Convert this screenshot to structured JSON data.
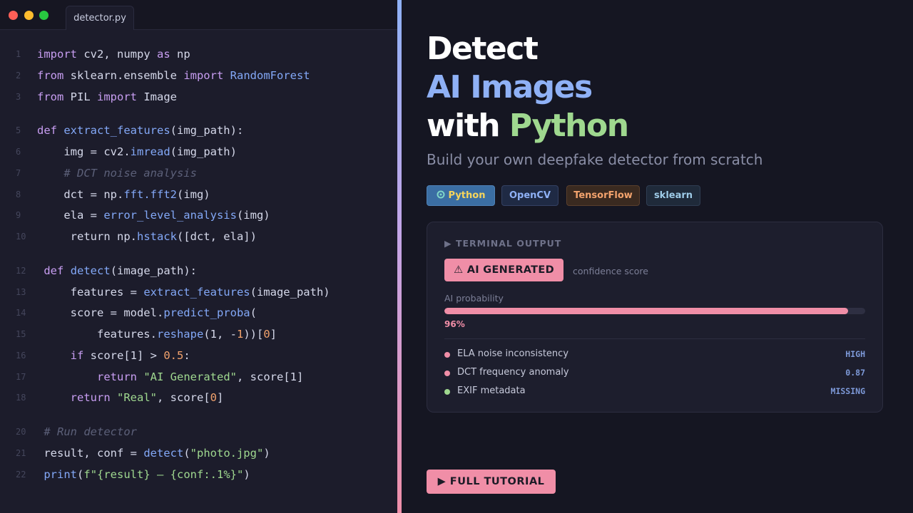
{
  "editor": {
    "tab_label": "detector.py",
    "window_controls": [
      {
        "name": "close",
        "color": "#ff5f57"
      },
      {
        "name": "minimize",
        "color": "#febc2e"
      },
      {
        "name": "maximize",
        "color": "#28c840"
      }
    ],
    "lines": [
      {
        "n": "1",
        "tokens": [
          [
            "kw",
            "import"
          ],
          [
            "pl",
            " cv2, numpy "
          ],
          [
            "kw",
            "as"
          ],
          [
            "pl",
            " np"
          ]
        ]
      },
      {
        "n": "2",
        "tokens": [
          [
            "kw",
            "from"
          ],
          [
            "pl",
            " sklearn.ensemble "
          ],
          [
            "kw",
            "import"
          ],
          [
            "pl",
            " "
          ],
          [
            "fn",
            "RandomForest"
          ]
        ]
      },
      {
        "n": "3",
        "tokens": [
          [
            "kw",
            "from"
          ],
          [
            "pl",
            " PIL "
          ],
          [
            "kw",
            "import"
          ],
          [
            "pl",
            " Image"
          ]
        ]
      },
      {
        "n": "5",
        "tokens": [
          [
            "kw",
            "def"
          ],
          [
            "pl",
            " "
          ],
          [
            "fn",
            "extract_features"
          ],
          [
            "pl",
            "(img_path):"
          ]
        ]
      },
      {
        "n": "6",
        "tokens": [
          [
            "pl",
            "    img = cv2."
          ],
          [
            "fn",
            "imread"
          ],
          [
            "pl",
            "(img_path)"
          ]
        ]
      },
      {
        "n": "7",
        "tokens": [
          [
            "cm",
            "    # DCT noise analysis"
          ]
        ]
      },
      {
        "n": "8",
        "tokens": [
          [
            "pl",
            "    dct = np."
          ],
          [
            "fn",
            "fft.fft2"
          ],
          [
            "pl",
            "(img)"
          ]
        ]
      },
      {
        "n": "9",
        "tokens": [
          [
            "pl",
            "    ela = "
          ],
          [
            "fn",
            "error_level_analysis"
          ],
          [
            "pl",
            "(img)"
          ]
        ]
      },
      {
        "n": "10",
        "tokens": [
          [
            "pl",
            "     return np."
          ],
          [
            "fn",
            "hstack"
          ],
          [
            "pl",
            "([dct, ela])"
          ]
        ]
      },
      {
        "n": "12",
        "tokens": [
          [
            "pl",
            " "
          ],
          [
            "kw",
            "def"
          ],
          [
            "pl",
            " "
          ],
          [
            "fn",
            "detect"
          ],
          [
            "pl",
            "(image_path):"
          ]
        ]
      },
      {
        "n": "13",
        "tokens": [
          [
            "pl",
            "     features = "
          ],
          [
            "fn",
            "extract_features"
          ],
          [
            "pl",
            "(image_path)"
          ]
        ]
      },
      {
        "n": "14",
        "tokens": [
          [
            "pl",
            "     score = model."
          ],
          [
            "fn",
            "predict_proba"
          ],
          [
            "pl",
            "("
          ]
        ]
      },
      {
        "n": "15",
        "tokens": [
          [
            "pl",
            "         features."
          ],
          [
            "fn",
            "reshape"
          ],
          [
            "pl",
            "(1, -"
          ],
          [
            "nu",
            "1"
          ],
          [
            "pl",
            "))["
          ],
          [
            "nu",
            "0"
          ],
          [
            "pl",
            "]"
          ]
        ]
      },
      {
        "n": "16",
        "tokens": [
          [
            "pl",
            "     "
          ],
          [
            "kw",
            "if"
          ],
          [
            "pl",
            " score[1] > "
          ],
          [
            "nu",
            "0.5"
          ],
          [
            "pl",
            ":"
          ]
        ]
      },
      {
        "n": "17",
        "tokens": [
          [
            "pl",
            "         "
          ],
          [
            "kw",
            "return"
          ],
          [
            "pl",
            " "
          ],
          [
            "st",
            "\"AI Generated\""
          ],
          [
            "pl",
            ", score[1]"
          ]
        ]
      },
      {
        "n": "18",
        "tokens": [
          [
            "pl",
            "     "
          ],
          [
            "kw",
            "return"
          ],
          [
            "pl",
            " "
          ],
          [
            "st",
            "\"Real\""
          ],
          [
            "pl",
            ", score["
          ],
          [
            "nu",
            "0"
          ],
          [
            "pl",
            "]"
          ]
        ]
      },
      {
        "n": "20",
        "tokens": [
          [
            "cm",
            " # Run detector"
          ]
        ]
      },
      {
        "n": "21",
        "tokens": [
          [
            "pl",
            " result, conf = "
          ],
          [
            "fn",
            "detect"
          ],
          [
            "pl",
            "("
          ],
          [
            "st",
            "\"photo.jpg\""
          ],
          [
            "pl",
            ")"
          ]
        ]
      },
      {
        "n": "22",
        "tokens": [
          [
            "pl",
            " "
          ],
          [
            "fn",
            "print"
          ],
          [
            "pl",
            "("
          ],
          [
            "st",
            "f\"{result} — {conf:.1%}\""
          ],
          [
            "pl",
            ")"
          ]
        ]
      }
    ]
  },
  "hero": {
    "line1": "Detect",
    "line2": "AI Images",
    "line3_prefix": "with ",
    "line3_highlight": "Python",
    "subtitle": "Build your own deepfake detector from scratch"
  },
  "tags": [
    {
      "label": "Python",
      "icon": "python-icon",
      "bg": "#3b6ea3",
      "border": "#4f82b8",
      "color": "#f6d55c"
    },
    {
      "label": "OpenCV",
      "bg": "#1f2a44",
      "border": "#344163",
      "color": "#8fb1f6"
    },
    {
      "label": "TensorFlow",
      "bg": "#3a2a20",
      "border": "#5a3f2c",
      "color": "#f3a36d"
    },
    {
      "label": "sklearn",
      "bg": "#1f2a3a",
      "border": "#2f3d52",
      "color": "#9ecbe8"
    }
  ],
  "terminal": {
    "title": "▶ TERMINAL OUTPUT",
    "verdict": "⚠ AI GENERATED",
    "confidence_label": "confidence score",
    "probability_label": "AI probability",
    "probability": 0.96,
    "probability_text": "96%",
    "indicators": [
      {
        "label": "ELA noise inconsistency",
        "value": "HIGH",
        "dot": "#f08ea7"
      },
      {
        "label": "DCT frequency anomaly",
        "value": "0.87",
        "dot": "#f08ea7"
      },
      {
        "label": "EXIF metadata",
        "value": "MISSING",
        "dot": "#9fd88f"
      }
    ]
  },
  "cta": {
    "label": "▶ FULL TUTORIAL"
  },
  "colors": {
    "accent_pink": "#f08ea7",
    "accent_blue": "#8fb1f6",
    "accent_green": "#9fd88f"
  }
}
